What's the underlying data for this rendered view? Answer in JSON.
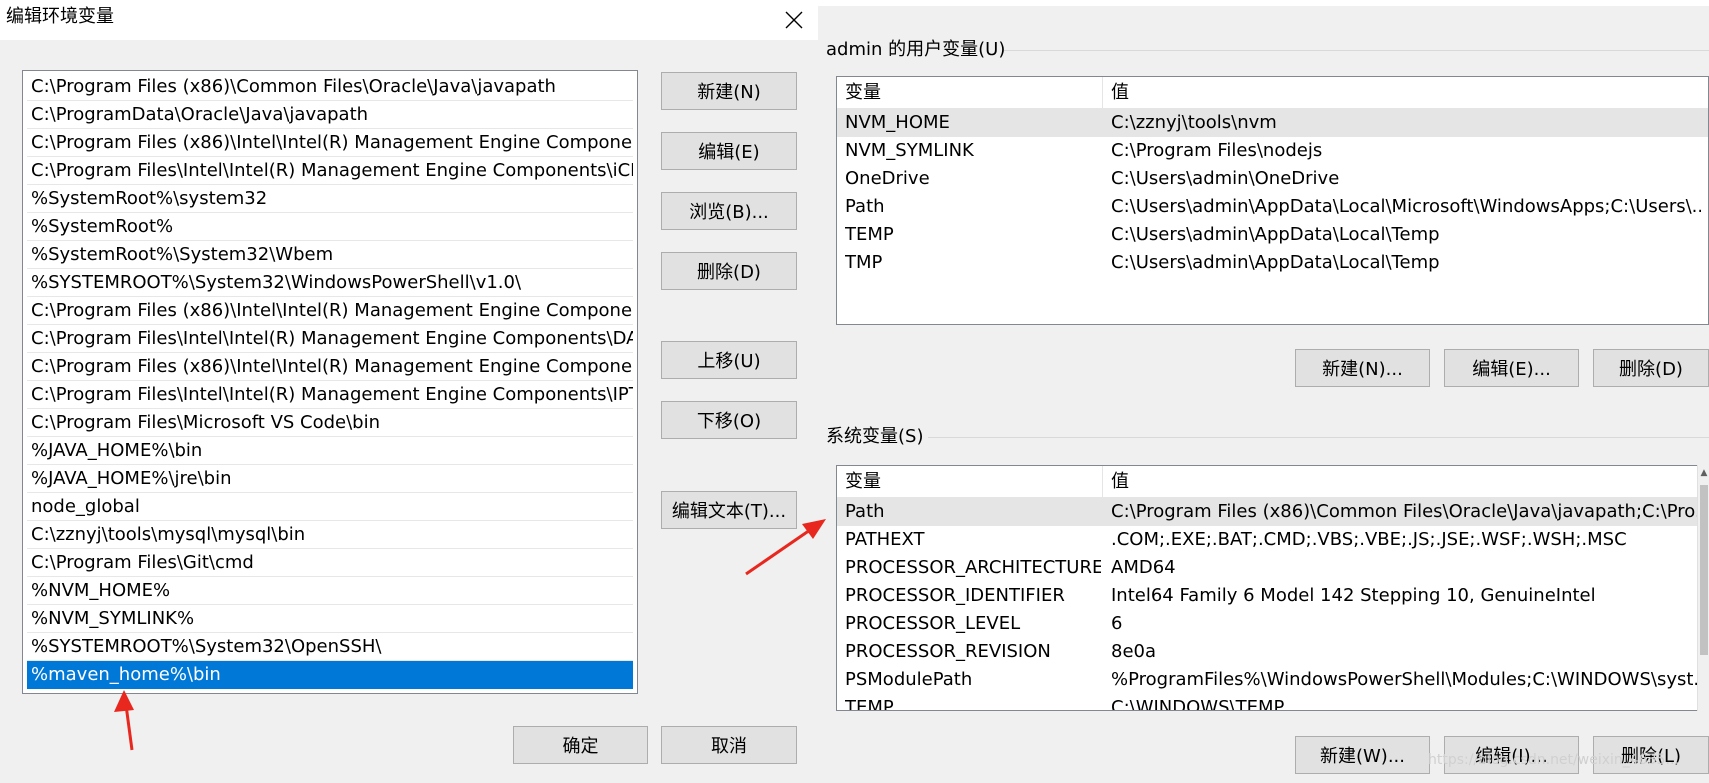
{
  "dialog": {
    "title": "编辑环境变量",
    "paths": [
      "C:\\Program Files (x86)\\Common Files\\Oracle\\Java\\javapath",
      "C:\\ProgramData\\Oracle\\Java\\javapath",
      "C:\\Program Files (x86)\\Intel\\Intel(R) Management Engine Componen…",
      "C:\\Program Files\\Intel\\Intel(R) Management Engine Components\\iCL…",
      "%SystemRoot%\\system32",
      "%SystemRoot%",
      "%SystemRoot%\\System32\\Wbem",
      "%SYSTEMROOT%\\System32\\WindowsPowerShell\\v1.0\\",
      "C:\\Program Files (x86)\\Intel\\Intel(R) Management Engine Componen…",
      "C:\\Program Files\\Intel\\Intel(R) Management Engine Components\\DAL",
      "C:\\Program Files (x86)\\Intel\\Intel(R) Management Engine Componen…",
      "C:\\Program Files\\Intel\\Intel(R) Management Engine Components\\IPT",
      "C:\\Program Files\\Microsoft VS Code\\bin",
      "%JAVA_HOME%\\bin",
      "%JAVA_HOME%\\jre\\bin",
      "node_global",
      "C:\\zznyj\\tools\\mysql\\mysql\\bin",
      "C:\\Program Files\\Git\\cmd",
      "%NVM_HOME%",
      "%NVM_SYMLINK%",
      "%SYSTEMROOT%\\System32\\OpenSSH\\",
      "%maven_home%\\bin"
    ],
    "buttons": {
      "new": "新建(N)",
      "edit": "编辑(E)",
      "browse": "浏览(B)...",
      "delete": "删除(D)",
      "move_up": "上移(U)",
      "move_down": "下移(O)",
      "edit_text": "编辑文本(T)...",
      "ok": "确定",
      "cancel": "取消"
    }
  },
  "user_vars": {
    "label": "admin 的用户变量(U)",
    "col_name": "变量",
    "col_value": "值",
    "rows": [
      {
        "name": "NVM_HOME",
        "value": "C:\\zznyj\\tools\\nvm"
      },
      {
        "name": "NVM_SYMLINK",
        "value": "C:\\Program Files\\nodejs"
      },
      {
        "name": "OneDrive",
        "value": "C:\\Users\\admin\\OneDrive"
      },
      {
        "name": "Path",
        "value": "C:\\Users\\admin\\AppData\\Local\\Microsoft\\WindowsApps;C:\\Users\\..."
      },
      {
        "name": "TEMP",
        "value": "C:\\Users\\admin\\AppData\\Local\\Temp"
      },
      {
        "name": "TMP",
        "value": "C:\\Users\\admin\\AppData\\Local\\Temp"
      }
    ],
    "buttons": {
      "new": "新建(N)...",
      "edit": "编辑(E)...",
      "delete": "删除(D)"
    }
  },
  "sys_vars": {
    "label": "系统变量(S)",
    "col_name": "变量",
    "col_value": "值",
    "rows": [
      {
        "name": "Path",
        "value": "C:\\Program Files (x86)\\Common Files\\Oracle\\Java\\javapath;C:\\Pro..."
      },
      {
        "name": "PATHEXT",
        "value": ".COM;.EXE;.BAT;.CMD;.VBS;.VBE;.JS;.JSE;.WSF;.WSH;.MSC"
      },
      {
        "name": "PROCESSOR_ARCHITECTURE",
        "value": "AMD64"
      },
      {
        "name": "PROCESSOR_IDENTIFIER",
        "value": "Intel64 Family 6 Model 142 Stepping 10, GenuineIntel"
      },
      {
        "name": "PROCESSOR_LEVEL",
        "value": "6"
      },
      {
        "name": "PROCESSOR_REVISION",
        "value": "8e0a"
      },
      {
        "name": "PSModulePath",
        "value": "%ProgramFiles%\\WindowsPowerShell\\Modules;C:\\WINDOWS\\syst..."
      },
      {
        "name": "TEMP",
        "value": "C:\\WINDOWS\\TEMP"
      }
    ],
    "buttons": {
      "new": "新建(W)...",
      "edit": "编辑(I)...",
      "delete": "删除(L)"
    }
  },
  "watermark": "https://blog.csdn.net/weixin_4635…",
  "colors": {
    "selection": "#0078d7",
    "arrow": "#e8281e"
  }
}
